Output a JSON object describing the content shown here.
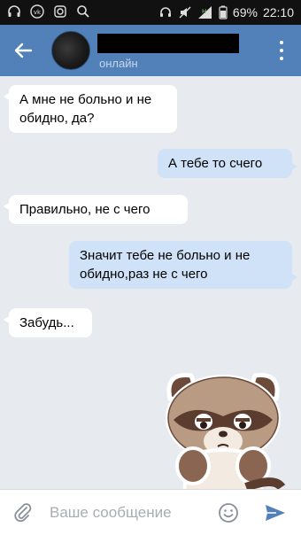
{
  "status_bar": {
    "battery_percent": "69%",
    "time": "22:10",
    "signal_label": "H",
    "left_icons": [
      "headphones-icon",
      "vk-icon",
      "instagram-icon",
      "search-icon"
    ],
    "right_icons": [
      "headset-icon",
      "mute-icon",
      "signal-icon",
      "battery-icon"
    ]
  },
  "header": {
    "back_icon": "arrow-left-icon",
    "status": "онлайн",
    "menu_icon": "more-vertical-icon"
  },
  "messages": [
    {
      "direction": "in",
      "text": "А мне не больно и не обидно, да?"
    },
    {
      "direction": "out",
      "text": "А тебе то счего"
    },
    {
      "direction": "in",
      "text": "Правильно, не с чего"
    },
    {
      "direction": "out",
      "text": "Значит тебе не больно и не обидно,раз не с чего"
    },
    {
      "direction": "in",
      "text": "Забудь..."
    },
    {
      "direction": "in",
      "type": "sticker",
      "sticker": "sad-raccoon-sticker"
    }
  ],
  "composer": {
    "placeholder": "Ваше сообщение",
    "value": "",
    "attach_icon": "paperclip-icon",
    "emoji_icon": "smiley-icon",
    "send_icon": "send-icon"
  },
  "colors": {
    "header": "#5181b8",
    "background": "#e7ebf0",
    "incoming_bubble": "#ffffff",
    "outgoing_bubble": "#cfe2f7",
    "accent": "#5181b8"
  }
}
